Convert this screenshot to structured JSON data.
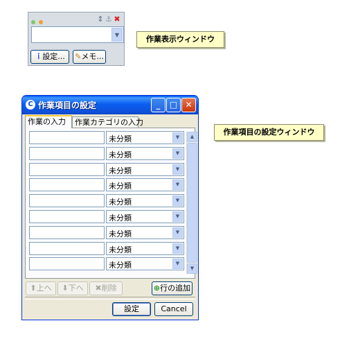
{
  "mini_widget": {
    "dot_colors": [
      "#7ec86b",
      "#f0a030"
    ],
    "controls": [
      "⇕",
      "⚓",
      "✖"
    ],
    "settings_label": "設定...",
    "memo_label": "メモ...",
    "dropdown_arrow": "▼"
  },
  "callouts": {
    "work_display": "作業表示ウィンドウ",
    "settings_window": "作業項目の設定ウィンドウ"
  },
  "window": {
    "title": "作業項目の設定",
    "title_icon": "C",
    "minimize": "_",
    "maximize": "□",
    "close": "✕",
    "tabs": [
      "作業の入力",
      "作業カテゴリの入力"
    ],
    "rows": [
      {
        "name": "",
        "category": "未分類"
      },
      {
        "name": "",
        "category": "未分類"
      },
      {
        "name": "",
        "category": "未分類"
      },
      {
        "name": "",
        "category": "未分類"
      },
      {
        "name": "",
        "category": "未分類"
      },
      {
        "name": "",
        "category": "未分類"
      },
      {
        "name": "",
        "category": "未分類"
      },
      {
        "name": "",
        "category": "未分類"
      },
      {
        "name": "",
        "category": "未分類"
      }
    ],
    "up_label": "上へ",
    "down_label": "下へ",
    "delete_label": "削除",
    "add_row_label": "行の追加",
    "ok_label": "設定",
    "cancel_label": "Cancel"
  }
}
